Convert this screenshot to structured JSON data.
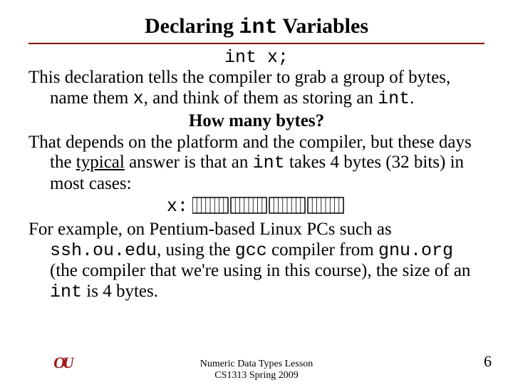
{
  "title": {
    "pre": "Declaring ",
    "code": "int",
    "post": " Variables"
  },
  "code_line": "int x;",
  "p1": {
    "t1": "This declaration tells the compiler to grab a group of bytes, name them ",
    "c1": "x",
    "t2": ", and think of them as storing an ",
    "c2": "int",
    "t3": "."
  },
  "subhead": "How many bytes?",
  "p2": {
    "t1": "That depends on the platform and the compiler, but these days the ",
    "u1": "typical",
    "t2": " answer is that an ",
    "c1": "int",
    "t3": " takes 4 bytes (32 bits) in most cases:"
  },
  "viz_label": "x:",
  "p3": {
    "t1": "For example, on Pentium-based Linux PCs such as ",
    "c1": "ssh.ou.edu",
    "t2": ", using the ",
    "c2": "gcc",
    "t3": " compiler from ",
    "c3": "gnu.org",
    "t4": " (the compiler that we're using in this course), the size of an ",
    "c4": "int",
    "t5": " is 4 bytes."
  },
  "footer": {
    "line1": "Numeric Data Types Lesson",
    "line2": "CS1313 Spring 2009"
  },
  "page_number": "6",
  "logo_text": "OU",
  "chart_data": {
    "type": "table",
    "description": "Visualization of an int taking 4 bytes = 32 bits",
    "bytes": 4,
    "bits_per_byte": 8,
    "total_bits": 32
  }
}
